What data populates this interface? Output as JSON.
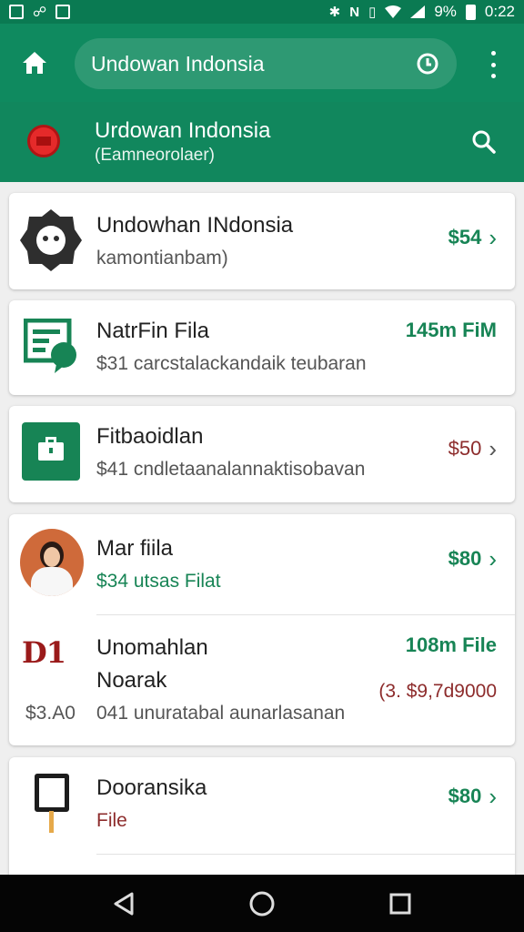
{
  "status_bar": {
    "battery": "9%",
    "time": "0:22",
    "left_icons": [
      "gallery-icon",
      "link-icon",
      "image-icon"
    ],
    "right_icons": [
      "bluetooth-icon",
      "nfc-icon",
      "vibrate-icon",
      "wifi-icon",
      "signal-icon",
      "battery-icon"
    ]
  },
  "app_bar": {
    "search_value": "Undowan Indonsia"
  },
  "channel": {
    "title": "Urdowan Indonsia",
    "subtitle": "(Eamneorolaer)"
  },
  "items": [
    {
      "title": "Undowhan INdonsia",
      "subtitle": "kamontianbam)",
      "meta": "$54",
      "icon": "chat-bot-icon",
      "meta_color": "green"
    },
    {
      "title": "NatrFin Fila",
      "subtitle": "$31 carcstalackandaik teubaran",
      "meta": "145m FiM",
      "icon": "document-chat-icon",
      "meta_color": "green"
    },
    {
      "title": "Fitbaoidlan",
      "subtitle": "$41 cndletaanalannaktisobavan",
      "meta": "$50",
      "icon": "briefcase-icon",
      "meta_color": "maroon"
    },
    {
      "title": "Mar fiila",
      "subtitle": "$34 utsas Filat",
      "meta": "$80",
      "icon": "avatar",
      "meta_color": "green"
    },
    {
      "title": "Unomahlan",
      "title2": "Noarak",
      "left_value": "$3.A0",
      "subtitle": "041 unuratabal aunarlasanan",
      "meta": "108m File",
      "price": "(3. $9,7d9000",
      "logo_text": "D1",
      "meta_color": "green"
    },
    {
      "title": "Dooransika",
      "subtitle": "File",
      "meta": "$80",
      "icon": "screen-icon",
      "meta_color": "green"
    }
  ]
}
